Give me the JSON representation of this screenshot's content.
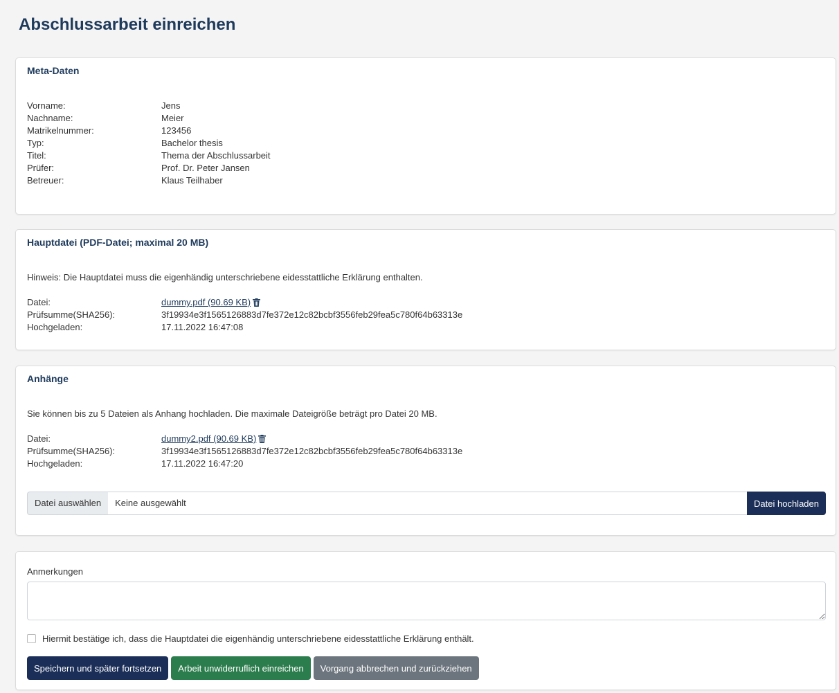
{
  "page": {
    "title": "Abschlussarbeit einreichen"
  },
  "meta": {
    "title": "Meta-Daten",
    "rows": [
      {
        "label": "Vorname:",
        "value": "Jens"
      },
      {
        "label": "Nachname:",
        "value": "Meier"
      },
      {
        "label": "Matrikelnummer:",
        "value": "123456"
      },
      {
        "label": "Typ:",
        "value": "Bachelor thesis"
      },
      {
        "label": "Titel:",
        "value": "Thema der Abschlussarbeit"
      },
      {
        "label": "Prüfer:",
        "value": "Prof. Dr. Peter Jansen"
      },
      {
        "label": "Betreuer:",
        "value": "Klaus Teilhaber"
      }
    ]
  },
  "main_file": {
    "title": "Hauptdatei (PDF-Datei; maximal 20 MB)",
    "note": "Hinweis: Die Hauptdatei muss die eigenhändig unterschriebene eidesstattliche Erklärung enthalten.",
    "file_label": "Datei:",
    "file_link": "dummy.pdf (90.69 KB)",
    "checksum_label": "Prüfsumme(SHA256):",
    "checksum": "3f19934e3f1565126883d7fe372e12c82bcbf3556feb29fea5c780f64b63313e",
    "uploaded_label": "Hochgeladen:",
    "uploaded": "17.11.2022 16:47:08"
  },
  "attachments": {
    "title": "Anhänge",
    "note": "Sie können bis zu 5 Dateien als Anhang hochladen. Die maximale Dateigröße beträgt pro Datei 20 MB.",
    "file_label": "Datei:",
    "file_link": "dummy2.pdf (90.69 KB)",
    "checksum_label": "Prüfsumme(SHA256):",
    "checksum": "3f19934e3f1565126883d7fe372e12c82bcbf3556feb29fea5c780f64b63313e",
    "uploaded_label": "Hochgeladen:",
    "uploaded": "17.11.2022 16:47:20",
    "choose_button": "Datei auswählen",
    "no_file": "Keine ausgewählt",
    "upload_button": "Datei hochladen"
  },
  "remarks": {
    "label": "Anmerkungen",
    "value": "",
    "confirm_text": "Hiermit bestätige ich, dass die Hauptdatei die eigenhändig unterschriebene eidesstattliche Erklärung enthält.",
    "confirm_checked": false,
    "save_button": "Speichern und später fortsetzen",
    "submit_button": "Arbeit unwiderruflich einreichen",
    "cancel_button": "Vorgang abbrechen und zurückziehen"
  },
  "colors": {
    "primary": "#1b2e58",
    "success": "#2c7d4d",
    "secondary": "#6c757d",
    "heading": "#1e3a5c"
  }
}
